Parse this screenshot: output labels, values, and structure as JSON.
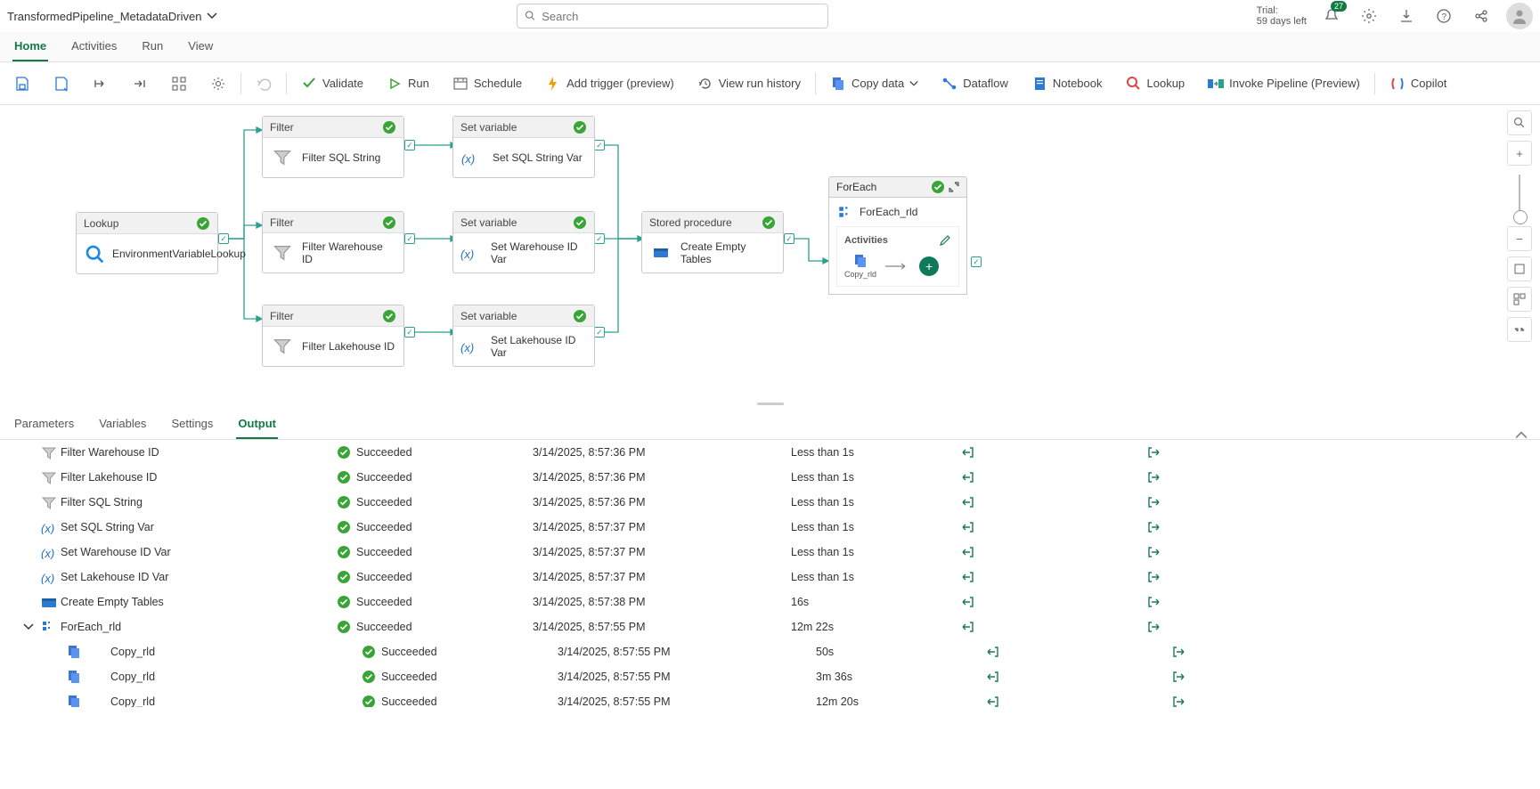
{
  "header": {
    "title": "TransformedPipeline_MetadataDriven",
    "search_placeholder": "Search",
    "trial_line1": "Trial:",
    "trial_line2": "59 days left",
    "notif_count": "27"
  },
  "tabs": {
    "home": "Home",
    "activities": "Activities",
    "run": "Run",
    "view": "View"
  },
  "toolbar": {
    "validate": "Validate",
    "run": "Run",
    "schedule": "Schedule",
    "add_trigger": "Add trigger (preview)",
    "history": "View run history",
    "copy_data": "Copy data",
    "dataflow": "Dataflow",
    "notebook": "Notebook",
    "lookup": "Lookup",
    "invoke": "Invoke Pipeline (Preview)",
    "copilot": "Copilot"
  },
  "nodes": {
    "lookup_type": "Lookup",
    "lookup_name": "EnvironmentVariableLookup",
    "filter_type": "Filter",
    "filter1_name": "Filter SQL String",
    "filter2_name": "Filter Warehouse ID",
    "filter3_name": "Filter Lakehouse ID",
    "setvar_type": "Set variable",
    "setvar1_name": "Set SQL String Var",
    "setvar2_name": "Set Warehouse ID Var",
    "setvar3_name": "Set Lakehouse ID Var",
    "sp_type": "Stored procedure",
    "sp_name": "Create Empty Tables",
    "foreach_type": "ForEach",
    "foreach_name": "ForEach_rld",
    "activities_label": "Activities",
    "copy_sub": "Copy_rld"
  },
  "btabs": {
    "parameters": "Parameters",
    "variables": "Variables",
    "settings": "Settings",
    "output": "Output"
  },
  "rows": [
    {
      "icon": "filter",
      "name": "Filter Warehouse ID",
      "status": "Succeeded",
      "time": "3/14/2025, 8:57:36 PM",
      "dur": "Less than 1s"
    },
    {
      "icon": "filter",
      "name": "Filter Lakehouse ID",
      "status": "Succeeded",
      "time": "3/14/2025, 8:57:36 PM",
      "dur": "Less than 1s"
    },
    {
      "icon": "filter",
      "name": "Filter SQL String",
      "status": "Succeeded",
      "time": "3/14/2025, 8:57:36 PM",
      "dur": "Less than 1s"
    },
    {
      "icon": "setvar",
      "name": "Set SQL String Var",
      "status": "Succeeded",
      "time": "3/14/2025, 8:57:37 PM",
      "dur": "Less than 1s"
    },
    {
      "icon": "setvar",
      "name": "Set Warehouse ID Var",
      "status": "Succeeded",
      "time": "3/14/2025, 8:57:37 PM",
      "dur": "Less than 1s"
    },
    {
      "icon": "setvar",
      "name": "Set Lakehouse ID Var",
      "status": "Succeeded",
      "time": "3/14/2025, 8:57:37 PM",
      "dur": "Less than 1s"
    },
    {
      "icon": "sp",
      "name": "Create Empty Tables",
      "status": "Succeeded",
      "time": "3/14/2025, 8:57:38 PM",
      "dur": "16s"
    },
    {
      "icon": "foreach",
      "name": "ForEach_rld",
      "status": "Succeeded",
      "time": "3/14/2025, 8:57:55 PM",
      "dur": "12m 22s",
      "expand": true
    },
    {
      "icon": "copy",
      "name": "Copy_rld",
      "status": "Succeeded",
      "time": "3/14/2025, 8:57:55 PM",
      "dur": "50s",
      "indent": true
    },
    {
      "icon": "copy",
      "name": "Copy_rld",
      "status": "Succeeded",
      "time": "3/14/2025, 8:57:55 PM",
      "dur": "3m 36s",
      "indent": true
    },
    {
      "icon": "copy",
      "name": "Copy_rld",
      "status": "Succeeded",
      "time": "3/14/2025, 8:57:55 PM",
      "dur": "12m 20s",
      "indent": true
    }
  ]
}
